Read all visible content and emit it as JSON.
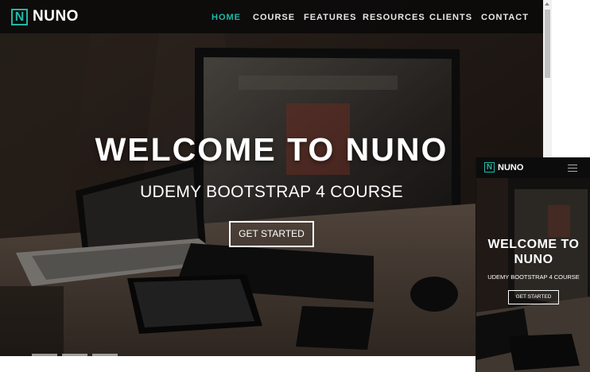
{
  "brand": {
    "logo_letter": "N",
    "name": "NUNO"
  },
  "nav": {
    "items": [
      {
        "label": "HOME",
        "active": true
      },
      {
        "label": "COURSE"
      },
      {
        "label": "FEATURES"
      },
      {
        "label": "RESOURCES"
      },
      {
        "label": "CLIENTS"
      },
      {
        "label": "CONTACT"
      }
    ]
  },
  "hero": {
    "title": "WELCOME TO NUNO",
    "subtitle": "UDEMY BOOTSTRAP 4 COURSE",
    "cta_label": "GET STARTED"
  },
  "mobile": {
    "title_line1": "WELCOME TO",
    "title_line2": "NUNO",
    "subtitle": "UDEMY BOOTSTRAP 4 COURSE",
    "cta_label": "GET STARTED"
  },
  "theme": {
    "accent": "#1fb8a6",
    "navbar_bg": "#0c0c0c",
    "text": "#ffffff"
  },
  "icons": {
    "menu": "hamburger-menu-icon",
    "logo": "brand-logo-icon"
  }
}
